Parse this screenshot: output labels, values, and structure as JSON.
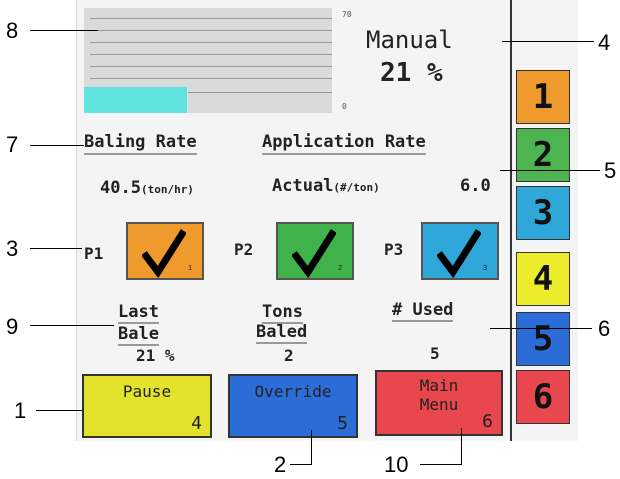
{
  "graph": {
    "scale_max": "70",
    "scale_min": "0",
    "fill_bars": 6
  },
  "status": {
    "mode": "Manual",
    "percent": "21 %"
  },
  "headings": {
    "baling_rate": "Baling Rate",
    "application_rate": "Application Rate"
  },
  "rates": {
    "baling_value": "40.5",
    "baling_unit": "(ton/hr)",
    "actual_label": "Actual",
    "actual_unit": "(#/ton)",
    "actual_value": "6.0"
  },
  "pumps": [
    {
      "label": "P1",
      "number": "1",
      "color": "#ef9a2c"
    },
    {
      "label": "P2",
      "number": "2",
      "color": "#3fb24a"
    },
    {
      "label": "P3",
      "number": "3",
      "color": "#2fa7d8"
    }
  ],
  "stats": {
    "last_bale_line1": "Last",
    "last_bale_line2": "Bale",
    "last_bale_value": "21 %",
    "tons_line1": "Tons",
    "tons_line2": "Baled",
    "tons_value": "2",
    "used_label": "# Used",
    "used_value": "5"
  },
  "buttons": {
    "pause": {
      "label": "Pause",
      "key": "4",
      "color": "#e3e32e"
    },
    "override": {
      "label": "Override",
      "key": "5",
      "color": "#2c6cd6"
    },
    "main_menu": {
      "line1": "Main",
      "line2": "Menu",
      "key": "6",
      "color": "#e8474e"
    }
  },
  "side_buttons": [
    {
      "label": "1",
      "color": "#ef9a2c"
    },
    {
      "label": "2",
      "color": "#4db44f"
    },
    {
      "label": "3",
      "color": "#2fa7d8"
    },
    {
      "label": "4",
      "color": "#ecec2c"
    },
    {
      "label": "5",
      "color": "#2c6cd6"
    },
    {
      "label": "6",
      "color": "#e8474e"
    }
  ],
  "callouts": [
    "1",
    "2",
    "3",
    "4",
    "5",
    "6",
    "7",
    "8",
    "9",
    "10"
  ]
}
